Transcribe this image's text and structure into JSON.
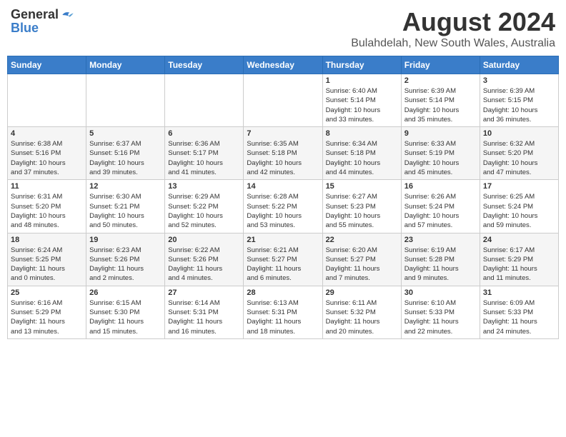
{
  "header": {
    "logo_general": "General",
    "logo_blue": "Blue",
    "title": "August 2024",
    "subtitle": "Bulahdelah, New South Wales, Australia"
  },
  "weekdays": [
    "Sunday",
    "Monday",
    "Tuesday",
    "Wednesday",
    "Thursday",
    "Friday",
    "Saturday"
  ],
  "weeks": [
    [
      {
        "day": "",
        "info": ""
      },
      {
        "day": "",
        "info": ""
      },
      {
        "day": "",
        "info": ""
      },
      {
        "day": "",
        "info": ""
      },
      {
        "day": "1",
        "info": "Sunrise: 6:40 AM\nSunset: 5:14 PM\nDaylight: 10 hours\nand 33 minutes."
      },
      {
        "day": "2",
        "info": "Sunrise: 6:39 AM\nSunset: 5:14 PM\nDaylight: 10 hours\nand 35 minutes."
      },
      {
        "day": "3",
        "info": "Sunrise: 6:39 AM\nSunset: 5:15 PM\nDaylight: 10 hours\nand 36 minutes."
      }
    ],
    [
      {
        "day": "4",
        "info": "Sunrise: 6:38 AM\nSunset: 5:16 PM\nDaylight: 10 hours\nand 37 minutes."
      },
      {
        "day": "5",
        "info": "Sunrise: 6:37 AM\nSunset: 5:16 PM\nDaylight: 10 hours\nand 39 minutes."
      },
      {
        "day": "6",
        "info": "Sunrise: 6:36 AM\nSunset: 5:17 PM\nDaylight: 10 hours\nand 41 minutes."
      },
      {
        "day": "7",
        "info": "Sunrise: 6:35 AM\nSunset: 5:18 PM\nDaylight: 10 hours\nand 42 minutes."
      },
      {
        "day": "8",
        "info": "Sunrise: 6:34 AM\nSunset: 5:18 PM\nDaylight: 10 hours\nand 44 minutes."
      },
      {
        "day": "9",
        "info": "Sunrise: 6:33 AM\nSunset: 5:19 PM\nDaylight: 10 hours\nand 45 minutes."
      },
      {
        "day": "10",
        "info": "Sunrise: 6:32 AM\nSunset: 5:20 PM\nDaylight: 10 hours\nand 47 minutes."
      }
    ],
    [
      {
        "day": "11",
        "info": "Sunrise: 6:31 AM\nSunset: 5:20 PM\nDaylight: 10 hours\nand 48 minutes."
      },
      {
        "day": "12",
        "info": "Sunrise: 6:30 AM\nSunset: 5:21 PM\nDaylight: 10 hours\nand 50 minutes."
      },
      {
        "day": "13",
        "info": "Sunrise: 6:29 AM\nSunset: 5:22 PM\nDaylight: 10 hours\nand 52 minutes."
      },
      {
        "day": "14",
        "info": "Sunrise: 6:28 AM\nSunset: 5:22 PM\nDaylight: 10 hours\nand 53 minutes."
      },
      {
        "day": "15",
        "info": "Sunrise: 6:27 AM\nSunset: 5:23 PM\nDaylight: 10 hours\nand 55 minutes."
      },
      {
        "day": "16",
        "info": "Sunrise: 6:26 AM\nSunset: 5:24 PM\nDaylight: 10 hours\nand 57 minutes."
      },
      {
        "day": "17",
        "info": "Sunrise: 6:25 AM\nSunset: 5:24 PM\nDaylight: 10 hours\nand 59 minutes."
      }
    ],
    [
      {
        "day": "18",
        "info": "Sunrise: 6:24 AM\nSunset: 5:25 PM\nDaylight: 11 hours\nand 0 minutes."
      },
      {
        "day": "19",
        "info": "Sunrise: 6:23 AM\nSunset: 5:26 PM\nDaylight: 11 hours\nand 2 minutes."
      },
      {
        "day": "20",
        "info": "Sunrise: 6:22 AM\nSunset: 5:26 PM\nDaylight: 11 hours\nand 4 minutes."
      },
      {
        "day": "21",
        "info": "Sunrise: 6:21 AM\nSunset: 5:27 PM\nDaylight: 11 hours\nand 6 minutes."
      },
      {
        "day": "22",
        "info": "Sunrise: 6:20 AM\nSunset: 5:27 PM\nDaylight: 11 hours\nand 7 minutes."
      },
      {
        "day": "23",
        "info": "Sunrise: 6:19 AM\nSunset: 5:28 PM\nDaylight: 11 hours\nand 9 minutes."
      },
      {
        "day": "24",
        "info": "Sunrise: 6:17 AM\nSunset: 5:29 PM\nDaylight: 11 hours\nand 11 minutes."
      }
    ],
    [
      {
        "day": "25",
        "info": "Sunrise: 6:16 AM\nSunset: 5:29 PM\nDaylight: 11 hours\nand 13 minutes."
      },
      {
        "day": "26",
        "info": "Sunrise: 6:15 AM\nSunset: 5:30 PM\nDaylight: 11 hours\nand 15 minutes."
      },
      {
        "day": "27",
        "info": "Sunrise: 6:14 AM\nSunset: 5:31 PM\nDaylight: 11 hours\nand 16 minutes."
      },
      {
        "day": "28",
        "info": "Sunrise: 6:13 AM\nSunset: 5:31 PM\nDaylight: 11 hours\nand 18 minutes."
      },
      {
        "day": "29",
        "info": "Sunrise: 6:11 AM\nSunset: 5:32 PM\nDaylight: 11 hours\nand 20 minutes."
      },
      {
        "day": "30",
        "info": "Sunrise: 6:10 AM\nSunset: 5:33 PM\nDaylight: 11 hours\nand 22 minutes."
      },
      {
        "day": "31",
        "info": "Sunrise: 6:09 AM\nSunset: 5:33 PM\nDaylight: 11 hours\nand 24 minutes."
      }
    ]
  ]
}
